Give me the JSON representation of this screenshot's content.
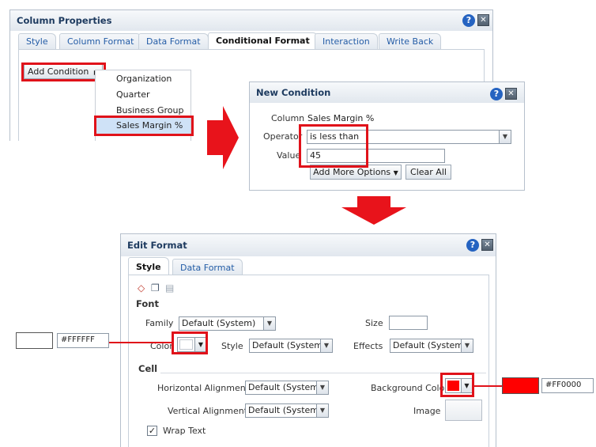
{
  "column_properties": {
    "title": "Column Properties",
    "tabs": [
      "Style",
      "Column Format",
      "Data Format",
      "Conditional Format",
      "Interaction",
      "Write Back"
    ],
    "active_tab": "Conditional Format",
    "add_condition_label": "Add Condition",
    "menu_items": [
      "Organization",
      "Quarter",
      "Business Group",
      "Sales Margin %"
    ],
    "selected_menu_item": "Sales Margin %"
  },
  "new_condition": {
    "title": "New Condition",
    "column_label": "Column",
    "column_value": "Sales Margin %",
    "operator_label": "Operator",
    "operator_value": "is less than",
    "value_label": "Value",
    "value_value": "45",
    "add_more_options_label": "Add More Options",
    "clear_all_label": "Clear All"
  },
  "edit_format": {
    "title": "Edit Format",
    "tabs": [
      "Style",
      "Data Format"
    ],
    "active_tab": "Style",
    "font_section": "Font",
    "family_label": "Family",
    "family_value": "Default (System)",
    "size_label": "Size",
    "size_value": "",
    "color_label": "Color",
    "style_label": "Style",
    "style_value": "Default (System)",
    "effects_label": "Effects",
    "effects_value": "Default (System)",
    "cell_section": "Cell",
    "h_align_label": "Horizontal Alignment",
    "h_align_value": "Default (System)",
    "bg_color_label": "Background Color",
    "v_align_label": "Vertical Alignment",
    "v_align_value": "Default (System)",
    "image_label": "Image",
    "wrap_text_label": "Wrap Text",
    "wrap_text_checked": true
  },
  "callouts": {
    "font_color_hex": "#FFFFFF",
    "background_color_hex": "#FF0000"
  },
  "colors": {
    "highlight": "#e0121a",
    "arrow": "#e8131b",
    "link_tab": "#235ca6",
    "background_swatch": "#FF0000",
    "font_swatch": "#FFFFFF"
  }
}
